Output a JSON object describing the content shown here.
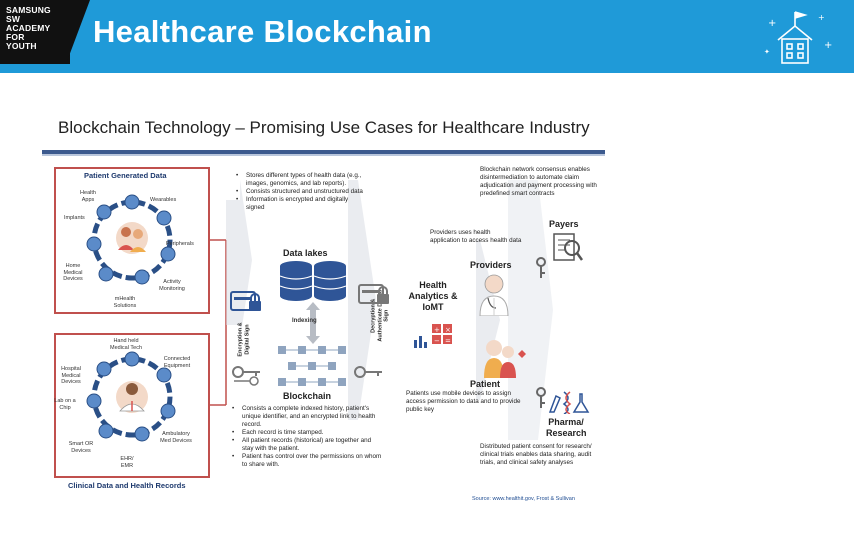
{
  "banner": {
    "logo_lines": [
      "SAMSUNG",
      "SW",
      "ACADEMY",
      "FOR",
      "YOUTH"
    ],
    "title": "Healthcare Blockchain"
  },
  "slide": {
    "title": "Blockchain Technology – Promising Use Cases for Healthcare Industry",
    "patient_generated": {
      "title": "Patient Generated Data",
      "labels": [
        "Health Apps",
        "Wearables",
        "Implants",
        "Peripherals",
        "Home Medical Devices",
        "Activity Monitoring",
        "mHealth Solutions"
      ]
    },
    "clinical": {
      "title": "Clinical Data and Health Records",
      "labels": [
        "Hand held Medical Tech",
        "Connected Equipment",
        "Hospital Medical Devices",
        "Lab on a Chip",
        "Ambulatory Med Devices",
        "Smart OR Devices",
        "EHR/ EMR"
      ]
    },
    "data_lakes": {
      "heading": "Data lakes",
      "bullets": [
        "Stores different types of health data (e.g., images, genomics, and lab reports).",
        "Consists structured and unstructured data",
        "Information is encrypted and digitally signed"
      ]
    },
    "indexing": "Indexing",
    "encryption_label": "Encryption & Digital Sign",
    "decryption_label": "Decryption & Authenticate Digital Sign",
    "blockchain": {
      "heading": "Blockchain",
      "bullets": [
        "Consists a complete indexed history, patient's unique identifier, and an encrypted link to health record.",
        "Each record is time stamped.",
        "All patient records (historical) are together and stay with the patient.",
        "Patient has control over the permissions on whom to share with."
      ]
    },
    "analytics": "Health Analytics & IoMT",
    "providers": {
      "heading": "Providers",
      "text": "Providers uses health application to access health data"
    },
    "patient": {
      "heading": "Patient",
      "text": "Patients use mobile devices to assign access permission to data and to provide public key"
    },
    "payers": {
      "heading": "Payers",
      "text": "Blockchain network consensus enables disintermediation to automate claim adjudication and payment processing with predefined smart contracts"
    },
    "pharma": {
      "heading": "Pharma/ Research",
      "text": "Distributed patient consent for research/ clinical trials enables data sharing, audit trials, and clinical safety analyses"
    },
    "source": "Source: www.healthit.gov, Frost & Sullivan"
  },
  "colors": {
    "banner": "#1f9ad8",
    "accent_red": "#c0504d",
    "navy": "#1e3a6e",
    "db_blue": "#2f5597"
  }
}
